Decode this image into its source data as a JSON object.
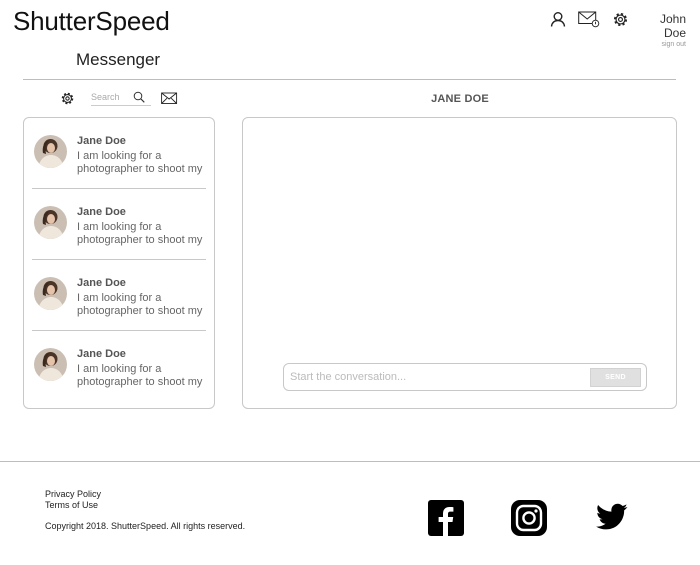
{
  "header": {
    "logo": "ShutterSpeed",
    "user_name": "John Doe",
    "sign_out": "sign out"
  },
  "icons": {
    "profile": "user-icon",
    "mail": "mail-notification-icon",
    "settings": "gear-icon",
    "search": "search-icon",
    "compose": "compose-mail-icon",
    "facebook": "facebook-icon",
    "instagram": "instagram-icon",
    "twitter": "twitter-icon"
  },
  "page": {
    "title": "Messenger"
  },
  "search": {
    "placeholder": "Search"
  },
  "conversation": {
    "name": "JANE DOE",
    "input_placeholder": "Start the conversation...",
    "send_label": "SEND"
  },
  "contacts": [
    {
      "name": "Jane Doe",
      "preview": "I am looking for a photographer to shoot my"
    },
    {
      "name": "Jane Doe",
      "preview": "I am looking for a photographer to shoot my"
    },
    {
      "name": "Jane Doe",
      "preview": "I am looking for a photographer to shoot my"
    },
    {
      "name": "Jane Doe",
      "preview": "I am looking for a photographer to shoot my"
    }
  ],
  "footer": {
    "privacy": "Privacy Policy",
    "terms": "Terms of Use",
    "copyright": "Copyright 2018. ShutterSpeed. All rights reserved."
  },
  "colors": {
    "border": "#c8c8c8",
    "send_button_bg": "#e0e0e0",
    "text_muted": "#666666"
  }
}
